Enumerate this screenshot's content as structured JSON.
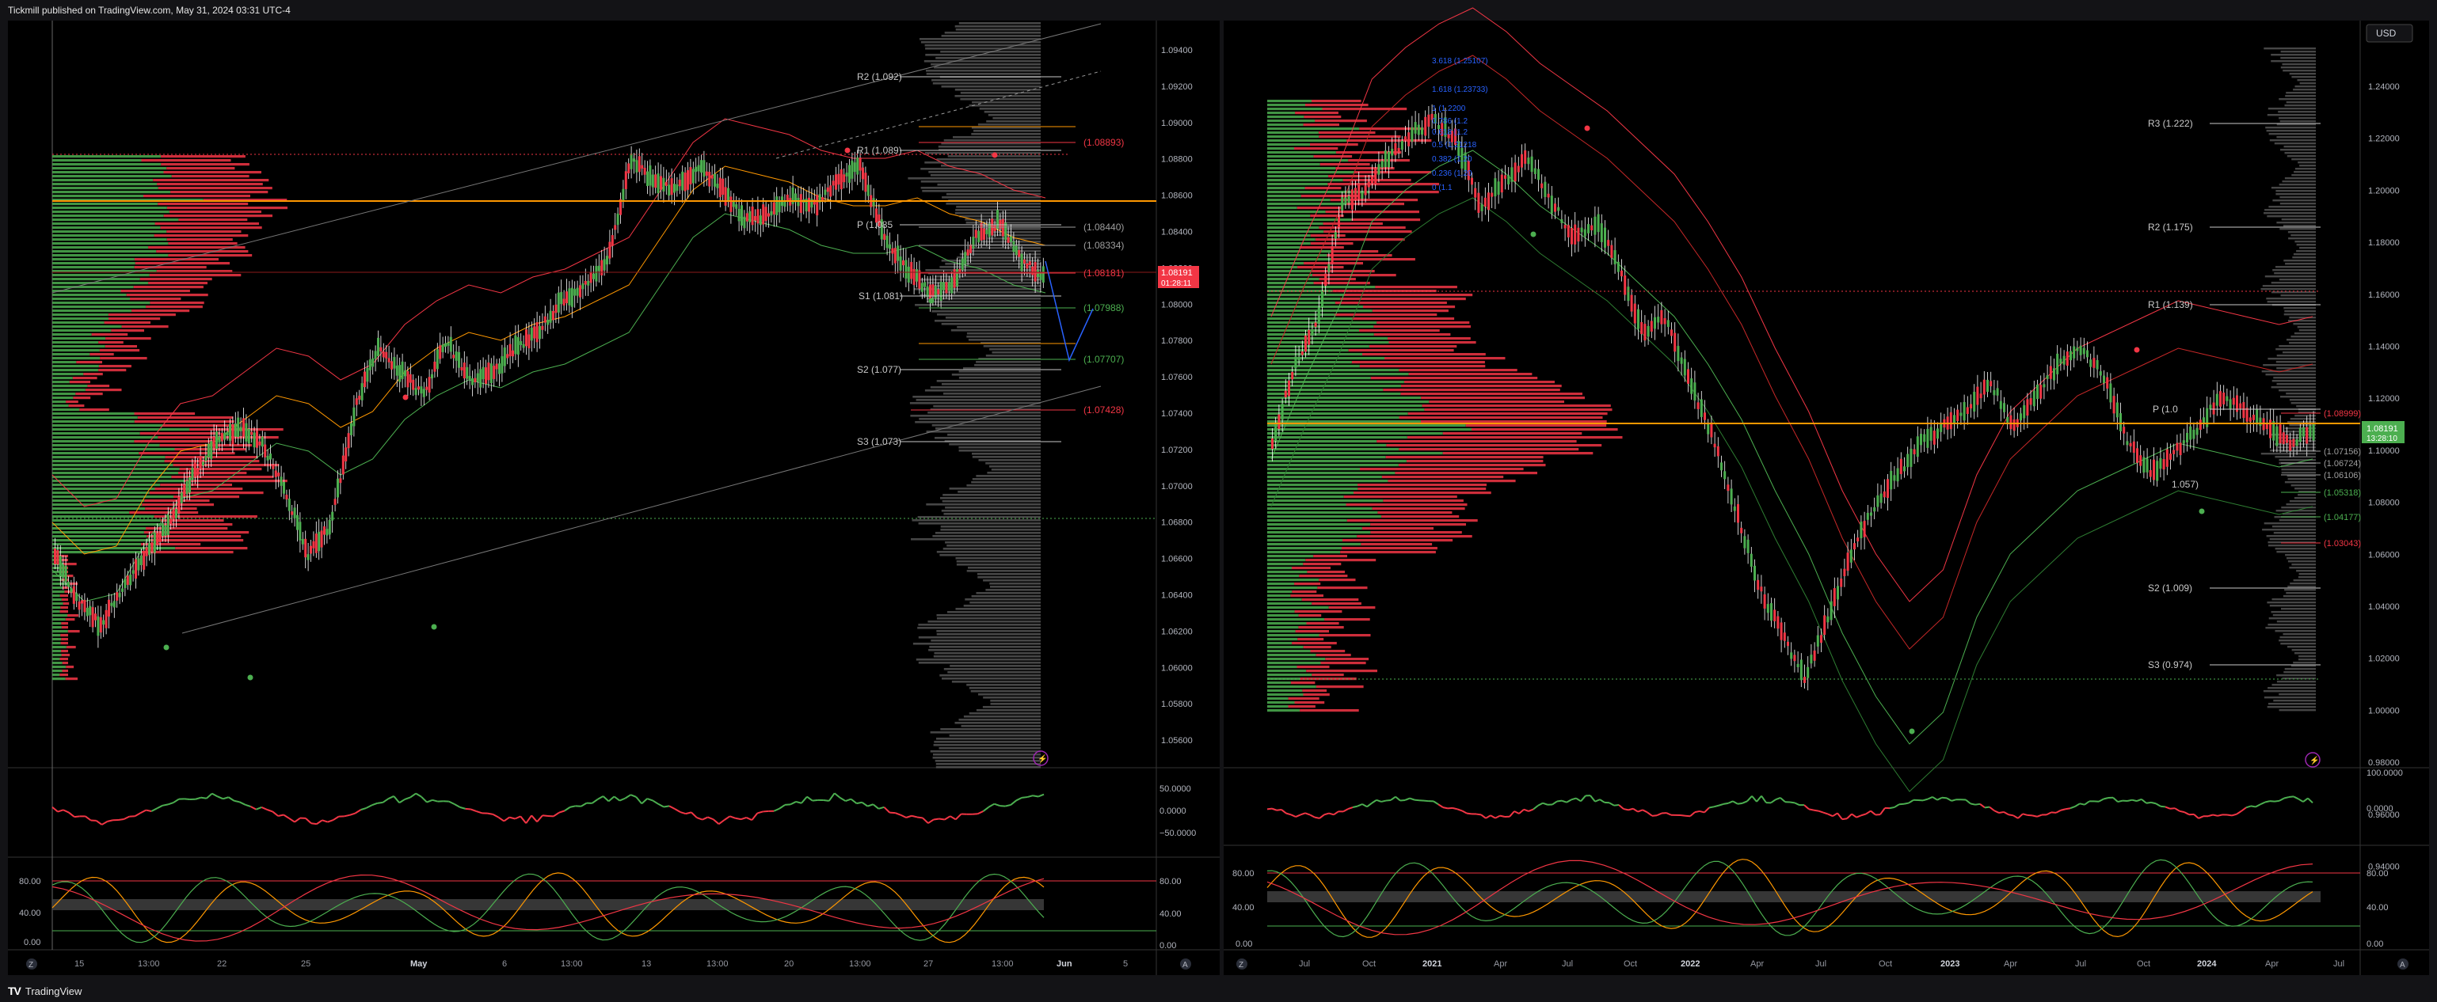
{
  "header": {
    "publish_credit": "Tickmill published on TradingView.com, May 31, 2024 03:31 UTC-4"
  },
  "footer": {
    "brand": "TradingView"
  },
  "left_chart": {
    "price_axis": [
      "1.09400",
      "1.09200",
      "1.09000",
      "1.08800",
      "1.08600",
      "1.08400",
      "1.08200",
      "1.08000",
      "1.07800",
      "1.07600",
      "1.07400",
      "1.07200",
      "1.07000",
      "1.06800",
      "1.06600",
      "1.06400",
      "1.06200",
      "1.06000",
      "1.05800",
      "1.05600"
    ],
    "pivot_labels": {
      "r2": "R2 (1.092)",
      "r1": "R1 (1.089)",
      "p": "P (1.085",
      "s1": "S1 (1.081)",
      "s2": "S2 (1.077)",
      "s3": "S3 (1.073)"
    },
    "level_labels": {
      "l1": "(1.08893)",
      "l2": "(1.08440)",
      "l3": "(1.08334)",
      "l4": "(1.08181)",
      "l5": "(1.07988)",
      "l6": "(1.07707)",
      "l7": "(1.07428)"
    },
    "current_price": "1.08191",
    "countdown": "01:28:11",
    "oscillator1_axis": [
      "50.0000",
      "0.0000",
      "−50.0000"
    ],
    "oscillator2_axis": [
      "80.00",
      "40.00",
      "0.00"
    ],
    "oscillator2_axis_left": [
      "80.00",
      "40.00",
      "0.00"
    ],
    "time_axis": [
      "15",
      "13:00",
      "22",
      "25",
      "May",
      "6",
      "13:00",
      "13",
      "13:00",
      "20",
      "13:00",
      "27",
      "13:00",
      "Jun",
      "5"
    ],
    "corner_left": "Z",
    "corner_right": "A"
  },
  "right_chart": {
    "currency_button": "USD",
    "price_axis": [
      "1.24000",
      "1.22000",
      "1.20000",
      "1.18000",
      "1.16000",
      "1.14000",
      "1.12000",
      "1.10000",
      "1.08000",
      "1.06000",
      "1.04000",
      "1.02000",
      "1.00000",
      "0.98000",
      "0.96000",
      "0.94000"
    ],
    "pivot_labels": {
      "r3": "R3 (1.222)",
      "r2": "R2 (1.175)",
      "r1": "R1 (1.139)",
      "p": "P (1.0",
      "s1": "1.057)",
      "s2": "S2 (1.009)",
      "s3": "S3 (0.974)"
    },
    "fib_labels": [
      "3.618 (1.25107)",
      "1.618 (1.23733)",
      "1 (1.2200",
      "0.786 (1.2",
      "0.618 (1.2",
      "0.5 (1.21218",
      "0.382 (1.20",
      "0.236 (1.20",
      "0 (1.1"
    ],
    "level_labels": {
      "l1": "(1.08999)",
      "l2": "(1.07156)",
      "l3": "(1.06724)",
      "l4": "(1.06106)",
      "l5": "(1.05318)",
      "l6": "(1.04177)",
      "l7": "(1.03043)"
    },
    "current_price": "1.08191",
    "countdown": "13:28:10",
    "oscillator1_axis": [
      "100.0000",
      "0.0000"
    ],
    "oscillator2_axis": [
      "80.00",
      "40.00",
      "0.00"
    ],
    "oscillator2_axis_left": [
      "80.00",
      "40.00",
      "0.00"
    ],
    "time_axis": [
      "Jul",
      "Oct",
      "2021",
      "Apr",
      "Jul",
      "Oct",
      "2022",
      "Apr",
      "Jul",
      "Oct",
      "2023",
      "Apr",
      "Jul",
      "Oct",
      "2024",
      "Apr",
      "Jul"
    ],
    "corner_left": "Z",
    "corner_right": "A"
  },
  "colors": {
    "background": "#000000",
    "bull": "#4caf50",
    "bear": "#f23645",
    "pivot": "#c8c8c8",
    "level_orange": "#ff9800",
    "volume_profile_gray": "#6b6b6b"
  }
}
